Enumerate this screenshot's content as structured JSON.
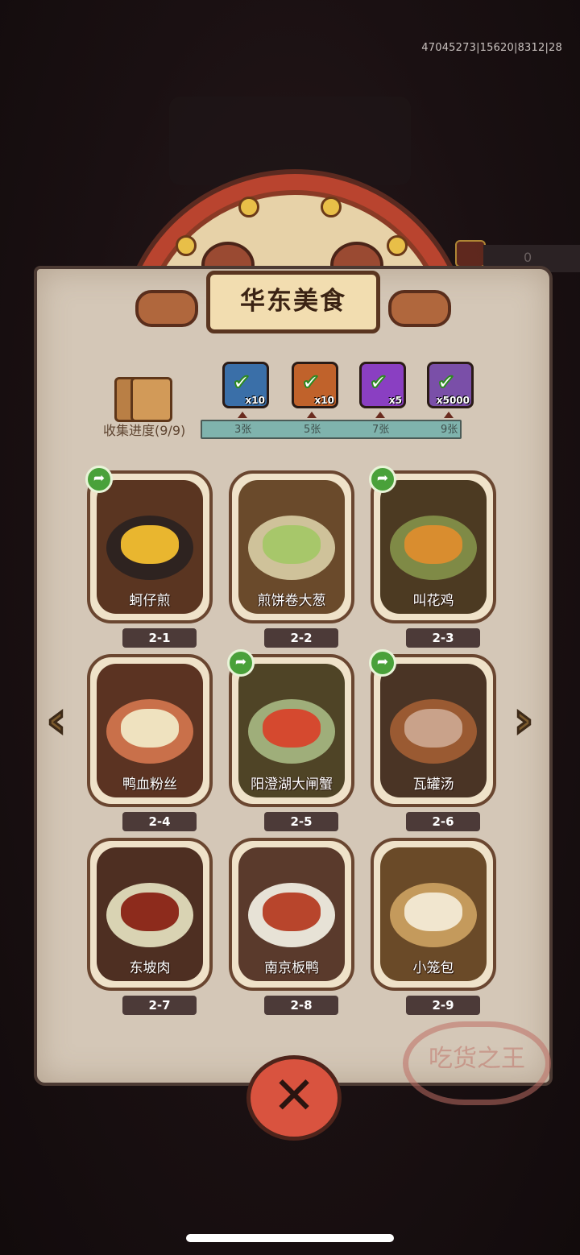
{
  "build_id": "47045273|15620|8312|28",
  "banner": {
    "title": "华东美食"
  },
  "collection": {
    "label": "收集进度(9/9)",
    "progress": 1.0,
    "ticks": [
      "3张",
      "5张",
      "7张",
      "9张"
    ],
    "rewards": [
      {
        "icon": "treasure-chest-icon",
        "count": "x10",
        "color": "#3a6fa8",
        "claimed": true
      },
      {
        "icon": "golden-key-icon",
        "count": "x10",
        "color": "#c0622b",
        "claimed": true
      },
      {
        "icon": "purple-gem-icon",
        "count": "x5",
        "color": "#8a3fc2",
        "claimed": true
      },
      {
        "icon": "silver-ticket-icon",
        "count": "x5000",
        "color": "#7a4fa8",
        "claimed": true
      }
    ]
  },
  "cards": [
    {
      "name": "蚵仔煎",
      "number": "2-1",
      "shareable": true,
      "bg": "#5a3521",
      "plate": "#2e2320",
      "food": "#e9b62f"
    },
    {
      "name": "煎饼卷大葱",
      "number": "2-2",
      "shareable": false,
      "bg": "#6a4a2b",
      "plate": "#cfc29a",
      "food": "#a7c76a"
    },
    {
      "name": "叫花鸡",
      "number": "2-3",
      "shareable": true,
      "bg": "#4c3a22",
      "plate": "#7f8a46",
      "food": "#d98d2f"
    },
    {
      "name": "鸭血粉丝",
      "number": "2-4",
      "shareable": false,
      "bg": "#5b3322",
      "plate": "#c9704a",
      "food": "#efe2bf"
    },
    {
      "name": "阳澄湖大闸蟹",
      "number": "2-5",
      "shareable": true,
      "bg": "#4f4426",
      "plate": "#9fae7a",
      "food": "#d5492f"
    },
    {
      "name": "瓦罐汤",
      "number": "2-6",
      "shareable": true,
      "bg": "#4a3425",
      "plate": "#9a5a32",
      "food": "#c9a28a"
    },
    {
      "name": "东坡肉",
      "number": "2-7",
      "shareable": false,
      "bg": "#4e2f22",
      "plate": "#d9d3b3",
      "food": "#8d2b1c"
    },
    {
      "name": "南京板鸭",
      "number": "2-8",
      "shareable": false,
      "bg": "#5a3a2c",
      "plate": "#e7e2d6",
      "food": "#b8452c"
    },
    {
      "name": "小笼包",
      "number": "2-9",
      "shareable": false,
      "bg": "#6a4a28",
      "plate": "#c49a5c",
      "food": "#f1e6cf"
    }
  ],
  "nav": {
    "prev_icon": "chevron-left-icon",
    "next_icon": "chevron-right-icon"
  },
  "close_icon": "close-x-icon",
  "stamp_text": "吃货之王"
}
